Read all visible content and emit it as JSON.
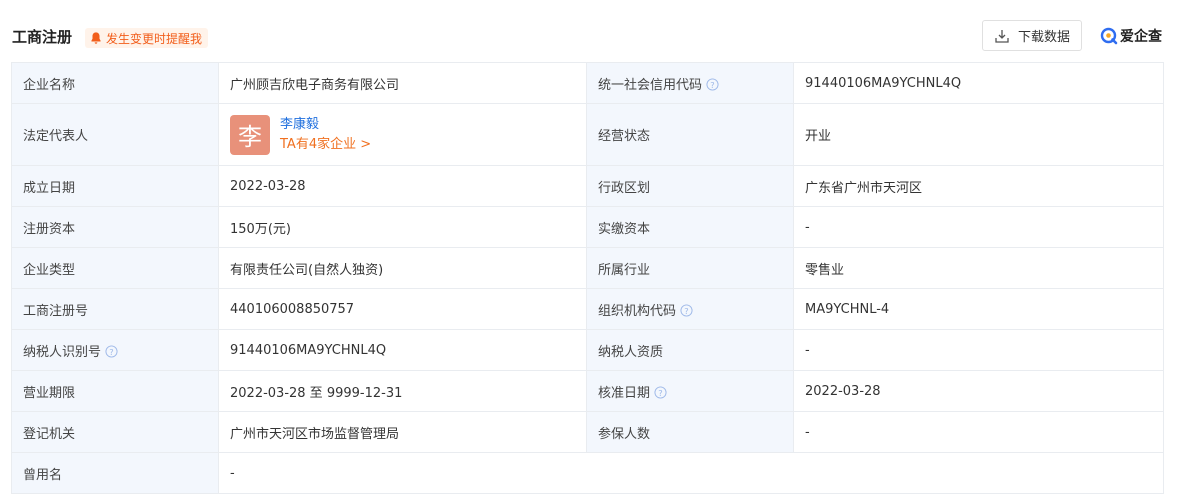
{
  "header": {
    "title": "工商注册",
    "notify_label": "发生变更时提醒我",
    "download_label": "下载数据",
    "brand_name": "爱企查"
  },
  "colors": {
    "label_bg": "#f3f7fd",
    "border": "#e9ecf0",
    "accent_blue": "#1f6fde",
    "accent_orange": "#f07020",
    "avatar_bg": "#e8917a"
  },
  "rows": [
    {
      "l1": "企业名称",
      "v1": "广州顾吉欣电子商务有限公司",
      "l2": "统一社会信用代码",
      "v2": "91440106MA9YCHNL4Q"
    },
    {
      "l1": "法定代表人",
      "avatar_char": "李",
      "rep_name": "李康毅",
      "rep_more": "TA有4家企业 >",
      "l2": "经营状态",
      "v2": "开业"
    },
    {
      "l1": "成立日期",
      "v1": "2022-03-28",
      "l2": "行政区划",
      "v2": "广东省广州市天河区"
    },
    {
      "l1": "注册资本",
      "v1": "150万(元)",
      "l2": "实缴资本",
      "v2": "-"
    },
    {
      "l1": "企业类型",
      "v1": "有限责任公司(自然人独资)",
      "l2": "所属行业",
      "v2": "零售业"
    },
    {
      "l1": "工商注册号",
      "v1": "440106008850757",
      "l2": "组织机构代码",
      "v2": "MA9YCHNL-4"
    },
    {
      "l1": "纳税人识别号",
      "v1": "91440106MA9YCHNL4Q",
      "l2": "纳税人资质",
      "v2": "-"
    },
    {
      "l1": "营业期限",
      "v1": "2022-03-28 至 9999-12-31",
      "l2": "核准日期",
      "v2": "2022-03-28"
    },
    {
      "l1": "登记机关",
      "v1": "广州市天河区市场监督管理局",
      "l2": "参保人数",
      "v2": "-"
    },
    {
      "l1": "曾用名",
      "v1": "-"
    }
  ]
}
